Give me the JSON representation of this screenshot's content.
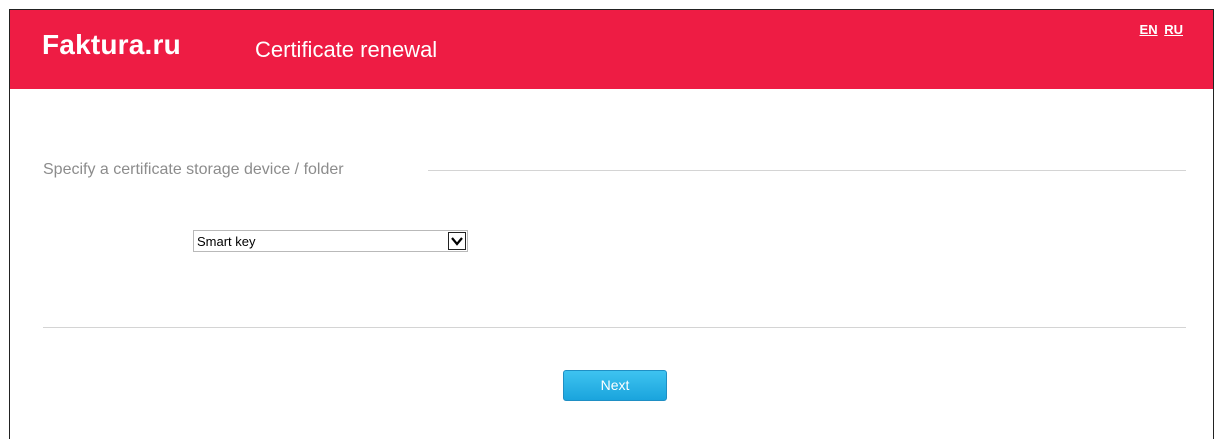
{
  "header": {
    "logo": "Faktura.ru",
    "title": "Certificate renewal",
    "lang_en": "EN",
    "lang_ru": "RU",
    "background_color": "#ee1c44"
  },
  "form": {
    "section_label": "Specify a certificate storage device / folder",
    "storage_select": {
      "selected": "Smart key"
    }
  },
  "actions": {
    "next_label": "Next",
    "next_color": "#1aa4dd"
  }
}
